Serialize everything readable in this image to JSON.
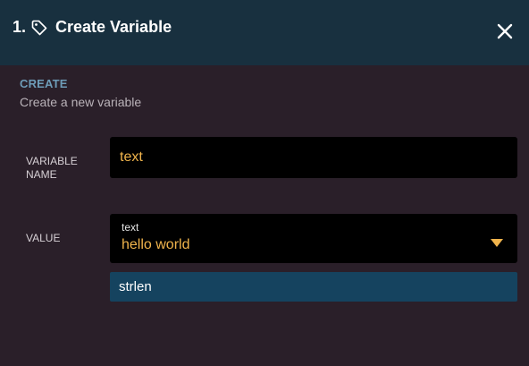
{
  "header": {
    "step": "1.",
    "icon": "tag-icon",
    "title": "Create Variable",
    "close_icon": "close-icon"
  },
  "section": {
    "label": "CREATE",
    "description": "Create a new variable"
  },
  "form": {
    "variable_name_label": "VARIABLE NAME",
    "variable_name_value": "text",
    "value_label": "VALUE",
    "value_type": "text",
    "value_text": "hello world",
    "suggestions": [
      "strlen"
    ]
  },
  "colors": {
    "header_bg": "#18303f",
    "body_bg": "#2a1f29",
    "accent_value": "#f0b44c",
    "section_label": "#6e9cb8",
    "suggestion_bg": "#15435f"
  }
}
